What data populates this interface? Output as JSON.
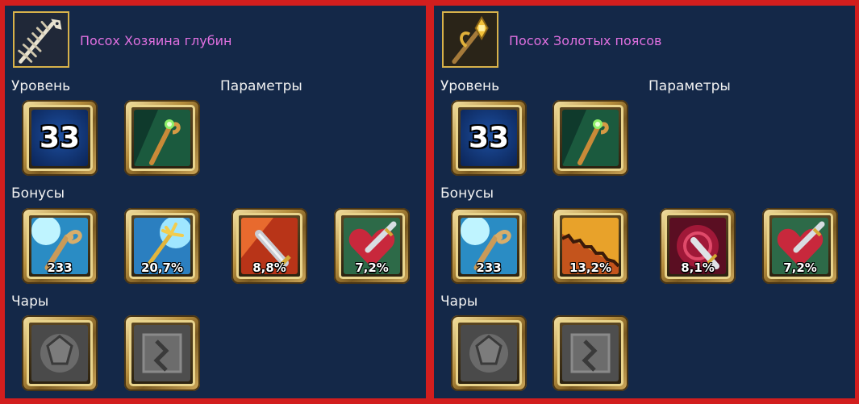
{
  "items": [
    {
      "name": "Посох Хозяина глубин",
      "labels": {
        "level": "Уровень",
        "params": "Параметры",
        "bonuses": "Бонусы",
        "charms": "Чары"
      },
      "level": "33",
      "bonuses": [
        {
          "icon": "staff-magic-icon",
          "value": "233"
        },
        {
          "icon": "trident-icon",
          "value": "20,7%"
        },
        {
          "icon": "sword-strike-icon",
          "value": "8,8%"
        },
        {
          "icon": "heart-sword-icon",
          "value": "7,2%"
        }
      ],
      "charms": [
        {
          "icon": "stone-rune-slot-icon"
        },
        {
          "icon": "stone-rune-slot-icon"
        }
      ]
    },
    {
      "name": "Посох Золотых поясов",
      "labels": {
        "level": "Уровень",
        "params": "Параметры",
        "bonuses": "Бонусы",
        "charms": "Чары"
      },
      "level": "33",
      "bonuses": [
        {
          "icon": "staff-magic-icon",
          "value": "233"
        },
        {
          "icon": "saw-blade-icon",
          "value": "13,2%"
        },
        {
          "icon": "crimson-sword-icon",
          "value": "8,1%"
        },
        {
          "icon": "heart-sword-icon",
          "value": "7,2%"
        }
      ],
      "charms": [
        {
          "icon": "stone-rune-slot-icon"
        },
        {
          "icon": "stone-rune-slot-icon"
        }
      ]
    }
  ],
  "colors": {
    "border": "#d21e1e",
    "panel": "#142848",
    "item_name": "#e070e0",
    "text": "#f2f2f2",
    "gold": "#d8b24a"
  }
}
